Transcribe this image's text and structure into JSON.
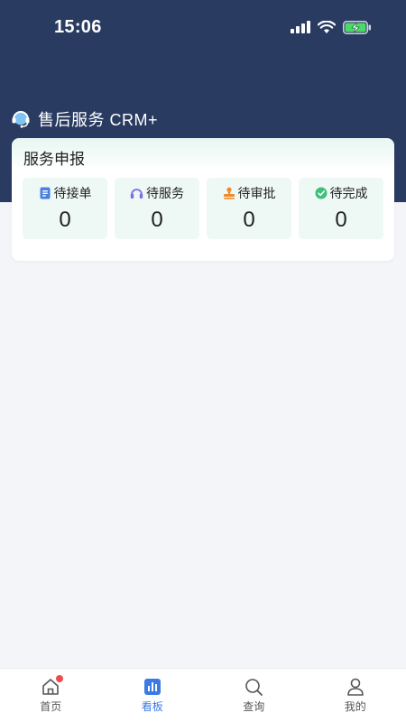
{
  "status_bar": {
    "time": "15:06"
  },
  "header": {
    "app_title": "售后服务 CRM+"
  },
  "card": {
    "title": "服务申报",
    "stats": [
      {
        "label": "待接单",
        "value": "0",
        "icon": "document-icon",
        "color": "#4a7fe0"
      },
      {
        "label": "待服务",
        "value": "0",
        "icon": "headset-icon",
        "color": "#7b6fe3"
      },
      {
        "label": "待审批",
        "value": "0",
        "icon": "stamp-icon",
        "color": "#f08a2c"
      },
      {
        "label": "待完成",
        "value": "0",
        "icon": "check-circle-icon",
        "color": "#3fbf7a"
      }
    ]
  },
  "tabbar": {
    "tabs": [
      {
        "label": "首页",
        "icon": "home-icon",
        "badge": true
      },
      {
        "label": "看板",
        "icon": "dashboard-icon",
        "active": true
      },
      {
        "label": "查询",
        "icon": "search-icon"
      },
      {
        "label": "我的",
        "icon": "user-icon"
      }
    ]
  },
  "colors": {
    "header_bg": "#2a3b62",
    "accent": "#3c7be6",
    "card_tint": "#eef8f4"
  }
}
